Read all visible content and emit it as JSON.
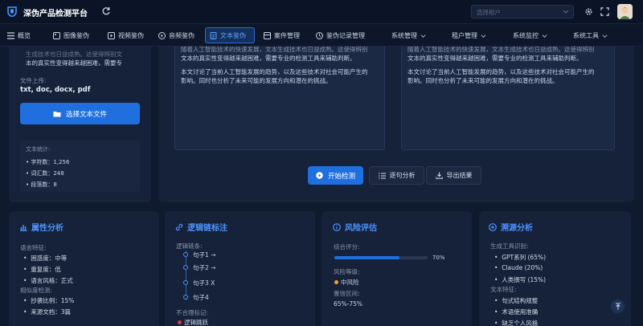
{
  "app": {
    "title": "深伪产品检测平台"
  },
  "header": {
    "tenant_placeholder": "选择租户"
  },
  "nav": [
    {
      "label": "概览",
      "icon": "grid-icon"
    },
    {
      "label": "图像鉴伪",
      "icon": "image-icon"
    },
    {
      "label": "视频鉴伪",
      "icon": "video-icon"
    },
    {
      "label": "音频鉴伪",
      "icon": "audio-icon"
    },
    {
      "label": "文本鉴伪",
      "icon": "document-icon",
      "active": true
    },
    {
      "label": "案件管理",
      "icon": "folder-icon"
    },
    {
      "label": "鉴伪记录管理",
      "icon": "history-icon"
    },
    {
      "label": "系统管理",
      "icon": "chevron-down-icon"
    },
    {
      "label": "租户管理",
      "icon": "chevron-down-icon"
    },
    {
      "label": "系统监控",
      "icon": "chevron-down-icon"
    },
    {
      "label": "系统工具",
      "icon": "chevron-down-icon"
    }
  ],
  "upload": {
    "text_line1": "生成技术也日益成熟。这使得辨别文",
    "text_line2": "本的真实性变得越来越困难，需要专",
    "file_label": "文件上传:",
    "file_types": "txt, doc, docx, pdf",
    "select_button": "选择文本文件",
    "stats_title": "文本统计:",
    "stats": [
      "• 字符数：1,256",
      "• 词汇数：248",
      "• 段落数：8"
    ]
  },
  "compare": {
    "left": {
      "line1": "随着人工智能技术的快速发展，文本生成技术也日益成熟。这使得辨别",
      "line2": "文本的真实性变得越来越困难，需要专业的检测工具来辅助判断。",
      "line3": "本文讨论了当前人工智能发展的趋势，以及这些技术对社会可能产生的",
      "line4": "影响。同时也分析了未来可能的发展方向和潜在的挑战。"
    },
    "right": {
      "line1": "随着人工智能技术的快速发展，文本生成技术也日益成熟。这使得辨别",
      "line2": "文本的真实性变得越来越困难，需要专业的检测工具来辅助判断。",
      "line3": "本文讨论了当前人工智能发展的趋势，以及这些技术对社会可能产生的",
      "line4": "影响。同时也分析了未来可能的发展方向和潜在的挑战。"
    }
  },
  "actions": {
    "start": "开始检测",
    "sentence": "逐句分析",
    "export": "导出结果"
  },
  "attr": {
    "title": "属性分析",
    "lang_label": "语言特征:",
    "lang_items": [
      "困惑度：中等",
      "重复度：低",
      "语言风格：正式"
    ],
    "sim_label": "相似度检测:",
    "sim_items": [
      "抄袭比例：15%",
      "来源文档：3篇"
    ]
  },
  "logic": {
    "title": "逻辑链标注",
    "chain_label": "逻辑链条:",
    "nodes": [
      "句子1 →",
      "句子2 →",
      "句子3 X",
      "句子4"
    ],
    "unreasonable_label": "不合理标记:",
    "unreasonable_item": "逻辑跳跃"
  },
  "risk": {
    "title": "风险评估",
    "score_label": "综合评分:",
    "score_percent": 70,
    "score_text": "70%",
    "level_label": "风险等级:",
    "level_value": "中风险",
    "level_color": "#f5a623",
    "range_label": "置信区间:",
    "range_value": "65%-75%"
  },
  "trace": {
    "title": "溯源分析",
    "tool_label": "生成工具识别:",
    "tools": [
      "GPT系列 (65%)",
      "Claude (20%)",
      "人类撰写 (15%)"
    ],
    "feature_label": "文本特征:",
    "features": [
      "句式结构规整",
      "术语使用准确",
      "缺乏个人风格"
    ]
  },
  "colors": {
    "accent": "#1f6fdf",
    "bg": "#0f1a2e",
    "card": "#16223a"
  }
}
